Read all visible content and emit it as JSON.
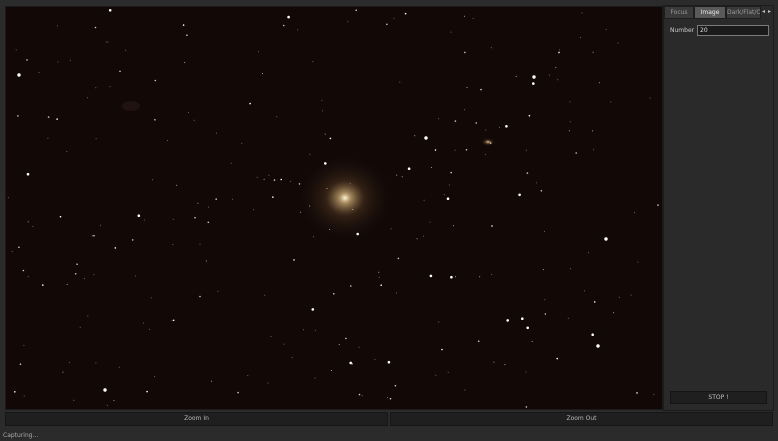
{
  "tabs": [
    {
      "label": "Focus",
      "active": false
    },
    {
      "label": "Image",
      "active": true
    },
    {
      "label": "Dark/Flat/Off",
      "active": false
    }
  ],
  "tab_nav": {
    "prev_icon": "◂",
    "next_icon": "▸"
  },
  "form": {
    "number_label": "Number",
    "number_value": "20"
  },
  "stop_label": "STOP !",
  "zoom_in_label": "Zoom In",
  "zoom_out_label": "Zoom Out",
  "status_text": "Capturing...",
  "colors": {
    "sky": "#120907",
    "panel": "#2a2a2a",
    "active_tab": "#595959"
  }
}
